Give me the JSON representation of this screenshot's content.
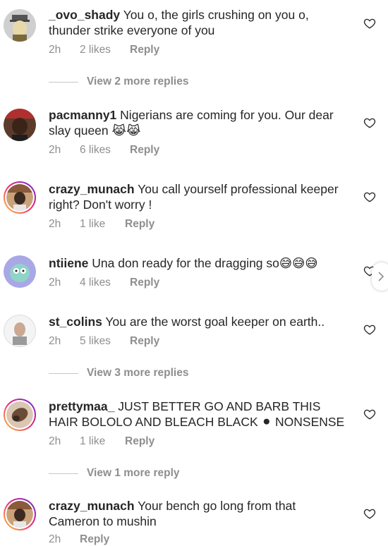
{
  "comments": [
    {
      "username": "_ovo_shady",
      "text": "You o, the girls crushing on you o, thunder strike everyone of you",
      "time": "2h",
      "likes": "2 likes",
      "reply": "Reply",
      "view_more": "View 2 more replies"
    },
    {
      "username": "pacmanny1",
      "text": "Nigerians are coming for you. Our dear slay queen 😹😹",
      "time": "2h",
      "likes": "6 likes",
      "reply": "Reply"
    },
    {
      "username": "crazy_munach",
      "text": "You call yourself professional keeper right? Don't worry !",
      "time": "2h",
      "likes": "1 like",
      "reply": "Reply"
    },
    {
      "username": "ntiiene",
      "text": "Una don ready for the dragging so😅😅😅",
      "time": "2h",
      "likes": "4 likes",
      "reply": "Reply"
    },
    {
      "username": "st_colins",
      "text": "You are the worst goal keeper on earth..",
      "time": "2h",
      "likes": "5 likes",
      "reply": "Reply",
      "view_more": "View 3 more replies"
    },
    {
      "username": "prettymaa_",
      "text": "JUST BETTER GO AND BARB THIS HAIR BOLOLO AND BLEACH BLACK ⚫ NONSENSE",
      "time": "2h",
      "likes": "1 like",
      "reply": "Reply",
      "view_more": "View 1 more reply"
    },
    {
      "username": "crazy_munach",
      "text": "Your bench go long from that Cameron to mushin",
      "time": "2h",
      "likes": "",
      "reply": "Reply"
    }
  ],
  "icons": {
    "like": "heart-outline-icon",
    "scroll": "chevron-right-icon"
  },
  "colors": {
    "text": "#262626",
    "secondary": "#8e8e8e"
  }
}
